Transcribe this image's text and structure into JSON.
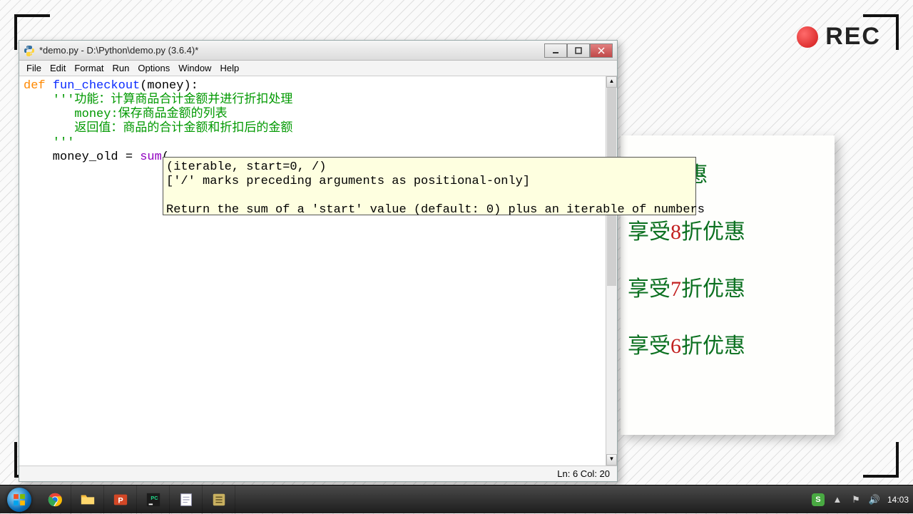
{
  "rec_label": "REC",
  "window": {
    "title": "*demo.py - D:\\Python\\demo.py (3.6.4)*",
    "menu": [
      "File",
      "Edit",
      "Format",
      "Run",
      "Options",
      "Window",
      "Help"
    ]
  },
  "code": {
    "kw_def": "def",
    "fn_name": "fun_checkout",
    "param_open": "(money):",
    "docstring_open": "    '''",
    "doc_line1": "功能：计算商品合计金额并进行折扣处理",
    "doc_indent": "       ",
    "doc_line2": "money:保存商品金额的列表",
    "doc_line3": "返回值：商品的合计金额和折扣后的金额",
    "docstring_close": "    '''",
    "assign_prefix": "    money_old = ",
    "builtin_sum": "sum",
    "assign_suffix": "("
  },
  "tooltip": {
    "line1": "(iterable, start=0, /)",
    "line2": "['/' marks preceding arguments as positional-only]",
    "line3": "",
    "line4": "Return the sum of a 'start' value (default: 0) plus an iterable of numbers"
  },
  "status": {
    "text": "Ln: 6  Col: 20"
  },
  "slide": {
    "line1_a": "...折优惠",
    "line2_a": "享受",
    "line2_n": "8",
    "line2_b": "折优惠",
    "line3_a": "享受",
    "line3_n": "7",
    "line3_b": "折优惠",
    "line4_a": "享受",
    "line4_n": "6",
    "line4_b": "折优惠"
  },
  "taskbar": {
    "apps": [
      "chrome",
      "file-explorer",
      "powerpoint",
      "pycharm",
      "notepad",
      "another-editor"
    ],
    "ime_label": "S",
    "clock": "14:03"
  }
}
